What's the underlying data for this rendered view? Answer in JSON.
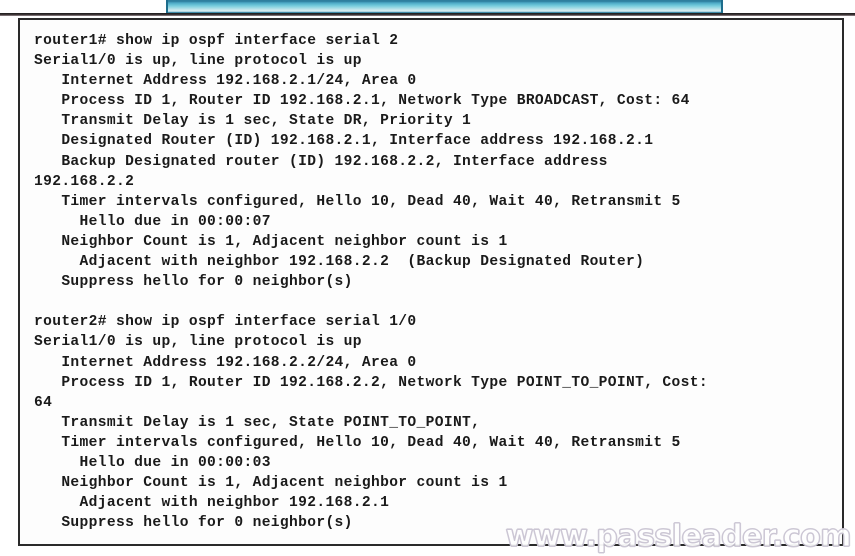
{
  "window": {
    "top_bar_accent": "#2e7f9e",
    "frame_border_color": "#2a2a2a",
    "background_color": "#fdfdfd"
  },
  "terminal": {
    "text_color": "#1a1a1a",
    "blocks": [
      {
        "prompt": "router1#",
        "command": "show ip ospf interface serial 2",
        "lines": [
          "router1# show ip ospf interface serial 2",
          "Serial1/0 is up, line protocol is up",
          "   Internet Address 192.168.2.1/24, Area 0",
          "   Process ID 1, Router ID 192.168.2.1, Network Type BROADCAST, Cost: 64",
          "   Transmit Delay is 1 sec, State DR, Priority 1",
          "   Designated Router (ID) 192.168.2.1, Interface address 192.168.2.1",
          "   Backup Designated router (ID) 192.168.2.2, Interface address",
          "192.168.2.2",
          "   Timer intervals configured, Hello 10, Dead 40, Wait 40, Retransmit 5",
          "     Hello due in 00:00:07",
          "   Neighbor Count is 1, Adjacent neighbor count is 1",
          "     Adjacent with neighbor 192.168.2.2  (Backup Designated Router)",
          "   Suppress hello for 0 neighbor(s)"
        ]
      },
      {
        "prompt": "router2#",
        "command": "show ip ospf interface serial 1/0",
        "lines": [
          "router2# show ip ospf interface serial 1/0",
          "Serial1/0 is up, line protocol is up",
          "   Internet Address 192.168.2.2/24, Area 0",
          "   Process ID 1, Router ID 192.168.2.2, Network Type POINT_TO_POINT, Cost:",
          "64",
          "   Transmit Delay is 1 sec, State POINT_TO_POINT,",
          "   Timer intervals configured, Hello 10, Dead 40, Wait 40, Retransmit 5",
          "     Hello due in 00:00:03",
          "   Neighbor Count is 1, Adjacent neighbor count is 1",
          "     Adjacent with neighbor 192.168.2.1",
          "   Suppress hello for 0 neighbor(s)"
        ]
      }
    ],
    "full_text": "router1# show ip ospf interface serial 2\nSerial1/0 is up, line protocol is up\n   Internet Address 192.168.2.1/24, Area 0\n   Process ID 1, Router ID 192.168.2.1, Network Type BROADCAST, Cost: 64\n   Transmit Delay is 1 sec, State DR, Priority 1\n   Designated Router (ID) 192.168.2.1, Interface address 192.168.2.1\n   Backup Designated router (ID) 192.168.2.2, Interface address\n192.168.2.2\n   Timer intervals configured, Hello 10, Dead 40, Wait 40, Retransmit 5\n     Hello due in 00:00:07\n   Neighbor Count is 1, Adjacent neighbor count is 1\n     Adjacent with neighbor 192.168.2.2  (Backup Designated Router)\n   Suppress hello for 0 neighbor(s)\n\nrouter2# show ip ospf interface serial 1/0\nSerial1/0 is up, line protocol is up\n   Internet Address 192.168.2.2/24, Area 0\n   Process ID 1, Router ID 192.168.2.2, Network Type POINT_TO_POINT, Cost:\n64\n   Transmit Delay is 1 sec, State POINT_TO_POINT,\n   Timer intervals configured, Hello 10, Dead 40, Wait 40, Retransmit 5\n     Hello due in 00:00:03\n   Neighbor Count is 1, Adjacent neighbor count is 1\n     Adjacent with neighbor 192.168.2.1\n   Suppress hello for 0 neighbor(s)"
  },
  "watermark": {
    "text": "www.passleader.com",
    "color": "#cfcad6"
  }
}
